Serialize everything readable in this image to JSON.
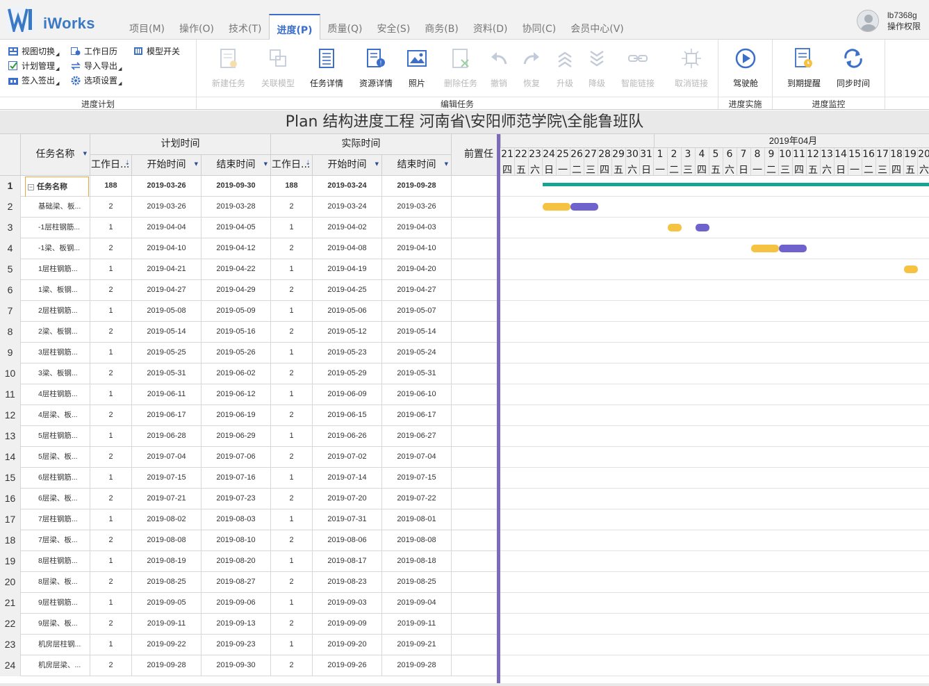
{
  "app": {
    "brand": "iWorks"
  },
  "menu": [
    {
      "label": "项目(M)",
      "active": false
    },
    {
      "label": "操作(O)",
      "active": false
    },
    {
      "label": "技术(T)",
      "active": false
    },
    {
      "label": "进度(P)",
      "active": true
    },
    {
      "label": "质量(Q)",
      "active": false
    },
    {
      "label": "安全(S)",
      "active": false
    },
    {
      "label": "商务(B)",
      "active": false
    },
    {
      "label": "资料(D)",
      "active": false
    },
    {
      "label": "协同(C)",
      "active": false
    },
    {
      "label": "会员中心(V)",
      "active": false
    }
  ],
  "user": {
    "name": "lb7368g",
    "role": "操作权限"
  },
  "ribbon": {
    "plan_group": {
      "label": "进度计划",
      "items": [
        {
          "label": "视图切换",
          "icon": "view-switch-icon"
        },
        {
          "label": "计划管理",
          "icon": "plan-manage-icon"
        },
        {
          "label": "签入签出",
          "icon": "checkin-icon"
        },
        {
          "label": "工作日历",
          "icon": "calendar-icon"
        },
        {
          "label": "导入导出",
          "icon": "import-export-icon"
        },
        {
          "label": "选项设置",
          "icon": "settings-gear-icon"
        },
        {
          "label": "模型开关",
          "icon": "model-toggle-icon"
        }
      ]
    },
    "edit_group": {
      "label": "编辑任务",
      "buttons": [
        {
          "label": "新建任务",
          "disabled": true,
          "icon": "new-task-icon"
        },
        {
          "label": "关联模型",
          "disabled": true,
          "icon": "link-model-icon"
        },
        {
          "label": "任务详情",
          "disabled": false,
          "icon": "task-detail-icon"
        },
        {
          "label": "资源详情",
          "disabled": false,
          "icon": "resource-detail-icon"
        },
        {
          "label": "照片",
          "disabled": false,
          "icon": "photo-icon"
        },
        {
          "label": "删除任务",
          "disabled": true,
          "icon": "delete-task-icon"
        },
        {
          "label": "撤销",
          "disabled": true,
          "icon": "undo-icon"
        },
        {
          "label": "恢复",
          "disabled": true,
          "icon": "redo-icon"
        },
        {
          "label": "升级",
          "disabled": true,
          "icon": "promote-icon"
        },
        {
          "label": "降级",
          "disabled": true,
          "icon": "demote-icon"
        },
        {
          "label": "智能链接",
          "disabled": true,
          "icon": "smart-link-icon"
        },
        {
          "label": "取消链接",
          "disabled": true,
          "icon": "unlink-icon"
        }
      ]
    },
    "impl_group": {
      "label": "进度实施",
      "buttons": [
        {
          "label": "驾驶舱",
          "icon": "cockpit-play-icon"
        }
      ]
    },
    "monitor_group": {
      "label": "进度监控",
      "buttons": [
        {
          "label": "到期提醒",
          "icon": "due-reminder-icon"
        },
        {
          "label": "同步时间",
          "icon": "sync-time-icon"
        }
      ]
    }
  },
  "plan_title": "Plan 结构进度工程 河南省\\安阳师范学院\\全能鲁班队",
  "table": {
    "header": {
      "task_name": "任务名称",
      "plan_group": "计划时间",
      "actual_group": "实际时间",
      "work_days": "工作日...",
      "start": "开始时间",
      "end": "结束时间",
      "predecessor": "前置任"
    },
    "rows": [
      {
        "n": "1",
        "name": "任务名称",
        "pd": "188",
        "ps": "2019-03-26",
        "pe": "2019-09-30",
        "ad": "188",
        "as": "2019-03-24",
        "ae": "2019-09-28"
      },
      {
        "n": "2",
        "name": "基础梁、板...",
        "pd": "2",
        "ps": "2019-03-26",
        "pe": "2019-03-28",
        "ad": "2",
        "as": "2019-03-24",
        "ae": "2019-03-26"
      },
      {
        "n": "3",
        "name": "-1层柱钢筋...",
        "pd": "1",
        "ps": "2019-04-04",
        "pe": "2019-04-05",
        "ad": "1",
        "as": "2019-04-02",
        "ae": "2019-04-03"
      },
      {
        "n": "4",
        "name": "-1梁、板钢...",
        "pd": "2",
        "ps": "2019-04-10",
        "pe": "2019-04-12",
        "ad": "2",
        "as": "2019-04-08",
        "ae": "2019-04-10"
      },
      {
        "n": "5",
        "name": "1层柱钢筋...",
        "pd": "1",
        "ps": "2019-04-21",
        "pe": "2019-04-22",
        "ad": "1",
        "as": "2019-04-19",
        "ae": "2019-04-20"
      },
      {
        "n": "6",
        "name": "1梁、板钢...",
        "pd": "2",
        "ps": "2019-04-27",
        "pe": "2019-04-29",
        "ad": "2",
        "as": "2019-04-25",
        "ae": "2019-04-27"
      },
      {
        "n": "7",
        "name": "2层柱钢筋...",
        "pd": "1",
        "ps": "2019-05-08",
        "pe": "2019-05-09",
        "ad": "1",
        "as": "2019-05-06",
        "ae": "2019-05-07"
      },
      {
        "n": "8",
        "name": "2梁、板钢...",
        "pd": "2",
        "ps": "2019-05-14",
        "pe": "2019-05-16",
        "ad": "2",
        "as": "2019-05-12",
        "ae": "2019-05-14"
      },
      {
        "n": "9",
        "name": "3层柱钢筋...",
        "pd": "1",
        "ps": "2019-05-25",
        "pe": "2019-05-26",
        "ad": "1",
        "as": "2019-05-23",
        "ae": "2019-05-24"
      },
      {
        "n": "10",
        "name": "3梁、板钢...",
        "pd": "2",
        "ps": "2019-05-31",
        "pe": "2019-06-02",
        "ad": "2",
        "as": "2019-05-29",
        "ae": "2019-05-31"
      },
      {
        "n": "11",
        "name": "4层柱钢筋...",
        "pd": "1",
        "ps": "2019-06-11",
        "pe": "2019-06-12",
        "ad": "1",
        "as": "2019-06-09",
        "ae": "2019-06-10"
      },
      {
        "n": "12",
        "name": "4层梁、板...",
        "pd": "2",
        "ps": "2019-06-17",
        "pe": "2019-06-19",
        "ad": "2",
        "as": "2019-06-15",
        "ae": "2019-06-17"
      },
      {
        "n": "13",
        "name": "5层柱钢筋...",
        "pd": "1",
        "ps": "2019-06-28",
        "pe": "2019-06-29",
        "ad": "1",
        "as": "2019-06-26",
        "ae": "2019-06-27"
      },
      {
        "n": "14",
        "name": "5层梁、板...",
        "pd": "2",
        "ps": "2019-07-04",
        "pe": "2019-07-06",
        "ad": "2",
        "as": "2019-07-02",
        "ae": "2019-07-04"
      },
      {
        "n": "15",
        "name": "6层柱钢筋...",
        "pd": "1",
        "ps": "2019-07-15",
        "pe": "2019-07-16",
        "ad": "1",
        "as": "2019-07-14",
        "ae": "2019-07-15"
      },
      {
        "n": "16",
        "name": "6层梁、板...",
        "pd": "2",
        "ps": "2019-07-21",
        "pe": "2019-07-23",
        "ad": "2",
        "as": "2019-07-20",
        "ae": "2019-07-22"
      },
      {
        "n": "17",
        "name": "7层柱钢筋...",
        "pd": "1",
        "ps": "2019-08-02",
        "pe": "2019-08-03",
        "ad": "1",
        "as": "2019-07-31",
        "ae": "2019-08-01"
      },
      {
        "n": "18",
        "name": "7层梁、板...",
        "pd": "2",
        "ps": "2019-08-08",
        "pe": "2019-08-10",
        "ad": "2",
        "as": "2019-08-06",
        "ae": "2019-08-08"
      },
      {
        "n": "19",
        "name": "8层柱钢筋...",
        "pd": "1",
        "ps": "2019-08-19",
        "pe": "2019-08-20",
        "ad": "1",
        "as": "2019-08-17",
        "ae": "2019-08-18"
      },
      {
        "n": "20",
        "name": "8层梁、板...",
        "pd": "2",
        "ps": "2019-08-25",
        "pe": "2019-08-27",
        "ad": "2",
        "as": "2019-08-23",
        "ae": "2019-08-25"
      },
      {
        "n": "21",
        "name": "9层柱钢筋...",
        "pd": "1",
        "ps": "2019-09-05",
        "pe": "2019-09-06",
        "ad": "1",
        "as": "2019-09-03",
        "ae": "2019-09-04"
      },
      {
        "n": "22",
        "name": "9层梁、板...",
        "pd": "2",
        "ps": "2019-09-11",
        "pe": "2019-09-13",
        "ad": "2",
        "as": "2019-09-09",
        "ae": "2019-09-11"
      },
      {
        "n": "23",
        "name": "机房层柱钢...",
        "pd": "1",
        "ps": "2019-09-22",
        "pe": "2019-09-23",
        "ad": "1",
        "as": "2019-09-20",
        "ae": "2019-09-21"
      },
      {
        "n": "24",
        "name": "机房层梁、...",
        "pd": "2",
        "ps": "2019-09-28",
        "pe": "2019-09-30",
        "ad": "2",
        "as": "2019-09-26",
        "ae": "2019-09-28"
      }
    ]
  },
  "gantt": {
    "month_label": "2019年04月",
    "timeline_start": "2019-03-21",
    "days": [
      {
        "d": "21",
        "w": "四"
      },
      {
        "d": "22",
        "w": "五"
      },
      {
        "d": "23",
        "w": "六"
      },
      {
        "d": "24",
        "w": "日"
      },
      {
        "d": "25",
        "w": "一"
      },
      {
        "d": "26",
        "w": "二"
      },
      {
        "d": "27",
        "w": "三"
      },
      {
        "d": "28",
        "w": "四"
      },
      {
        "d": "29",
        "w": "五"
      },
      {
        "d": "30",
        "w": "六"
      },
      {
        "d": "31",
        "w": "日"
      },
      {
        "d": "1",
        "w": "一"
      },
      {
        "d": "2",
        "w": "二"
      },
      {
        "d": "3",
        "w": "三"
      },
      {
        "d": "4",
        "w": "四"
      },
      {
        "d": "5",
        "w": "五"
      },
      {
        "d": "6",
        "w": "六"
      },
      {
        "d": "7",
        "w": "日"
      },
      {
        "d": "8",
        "w": "一"
      },
      {
        "d": "9",
        "w": "二"
      },
      {
        "d": "10",
        "w": "三"
      },
      {
        "d": "11",
        "w": "四"
      },
      {
        "d": "12",
        "w": "五"
      },
      {
        "d": "13",
        "w": "六"
      },
      {
        "d": "14",
        "w": "日"
      },
      {
        "d": "15",
        "w": "一"
      },
      {
        "d": "16",
        "w": "二"
      },
      {
        "d": "17",
        "w": "三"
      },
      {
        "d": "18",
        "w": "四"
      },
      {
        "d": "19",
        "w": "五"
      },
      {
        "d": "20",
        "w": "六"
      }
    ],
    "colors": {
      "plan": "#f6c242",
      "actual": "#6f62cc",
      "summary": "#17a593",
      "splitter": "#7b6bb8",
      "accent": "#3b6fc9"
    }
  }
}
